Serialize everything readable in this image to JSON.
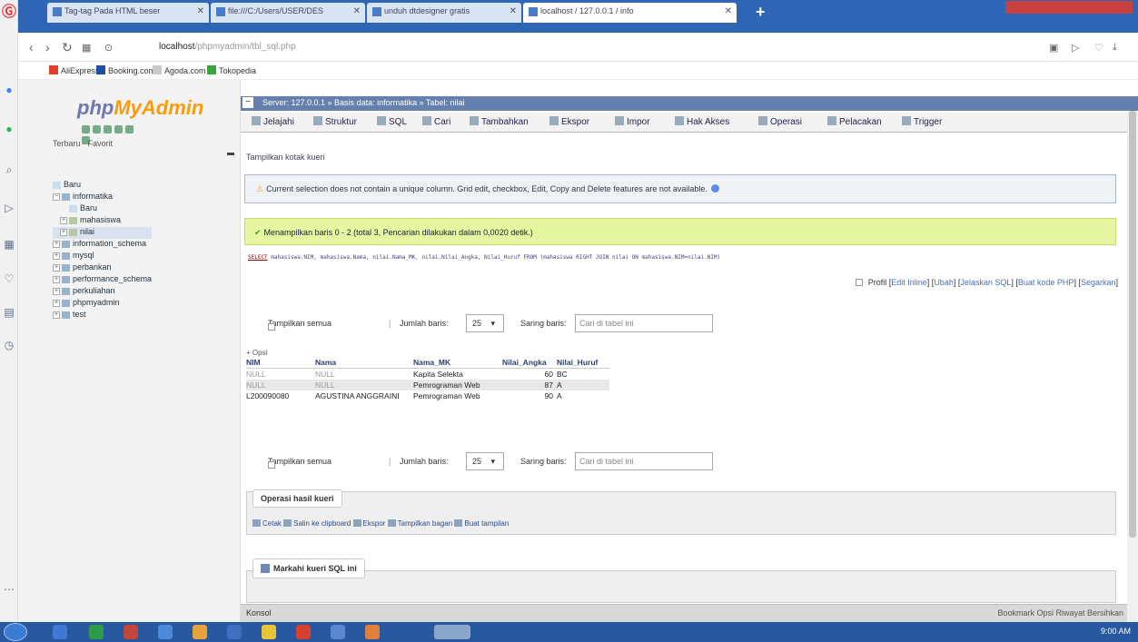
{
  "browser": {
    "tabs": [
      {
        "title": "Tag-tag Pada HTML beser"
      },
      {
        "title": "file:///C:/Users/USER/DES"
      },
      {
        "title": "unduh dtdesigner gratis"
      },
      {
        "title": "localhost / 127.0.0.1 / info"
      }
    ],
    "url_host": "localhost",
    "url_path": "/phpmyadmin/tbl_sql.php",
    "bookmarks": [
      "AliExpress",
      "Booking.com",
      "Agoda.com",
      "Tokopedia"
    ]
  },
  "sidebar": {
    "logo_a": "php",
    "logo_b": "MyAdmin",
    "recent": "Terbaru",
    "favorit": "Favorit",
    "tree": [
      {
        "label": "Baru",
        "level": 0
      },
      {
        "label": "informatika",
        "level": 0
      },
      {
        "label": "Baru",
        "level": 1
      },
      {
        "label": "mahasiswa",
        "level": 1
      },
      {
        "label": "nilai",
        "level": 1
      },
      {
        "label": "information_schema",
        "level": 0
      },
      {
        "label": "mysql",
        "level": 0
      },
      {
        "label": "perbankan",
        "level": 0
      },
      {
        "label": "performance_schema",
        "level": 0
      },
      {
        "label": "perkuliahan",
        "level": 0
      },
      {
        "label": "phpmyadmin",
        "level": 0
      },
      {
        "label": "test",
        "level": 0
      }
    ]
  },
  "breadcrumb": "Server: 127.0.0.1 » Basis data: informatika » Tabel: nilai",
  "menu": [
    "Jelajahi",
    "Struktur",
    "SQL",
    "Cari",
    "Tambahkan",
    "Ekspor",
    "Impor",
    "Hak Akses",
    "Operasi",
    "Pelacakan",
    "Trigger"
  ],
  "hint": "Tampilkan kotak kueri",
  "warning": "Current selection does not contain a unique column. Grid edit, checkbox, Edit, Copy and Delete features are not available.",
  "success": "Menampilkan baris 0 - 2 (total 3, Pencarian dilakukan dalam 0,0020 detik.)",
  "sql_keyword": "SELECT",
  "sql_rest": " mahasiswa.NIM, mahasiswa.Nama, nilai.Nama_MK, nilai.Nilai_Angka, Nilai_Huruf FROM (mahasiswa RIGHT JOIN nilai ON mahasiswa.NIM=nilai.NIM)",
  "profil": {
    "label": "Profil",
    "links": [
      "Edit Inline",
      "Ubah",
      "Jelaskan SQL",
      "Buat kode PHP",
      "Segarkan"
    ]
  },
  "controls": {
    "show_all": "Tampilkan semua",
    "rows_label": "Jumlah baris:",
    "rows_value": "25",
    "filter_label": "Saring baris:",
    "filter_placeholder": "Cari di tabel ini"
  },
  "opsi": "+ Opsi",
  "table": {
    "headers": [
      "NIM",
      "Nama",
      "Nama_MK",
      "Nilai_Angka",
      "Nilai_Huruf"
    ],
    "rows": [
      [
        "NULL",
        "NULL",
        "Kapita Selekta",
        "60",
        "BC"
      ],
      [
        "NULL",
        "NULL",
        "Pemrograman Web",
        "87",
        "A"
      ],
      [
        "L200090080",
        "AGUSTINA ANGGRAINI",
        "Pemrograman Web",
        "90",
        "A"
      ]
    ]
  },
  "query_ops": {
    "title": "Operasi hasil kueri",
    "links": [
      "Cetak",
      "Salin ke clipboard",
      "Ekspor",
      "Tampilkan bagan",
      "Buat tampilan"
    ]
  },
  "bookmark_sql": {
    "title": "Markahi kueri SQL ini"
  },
  "console": {
    "label": "Konsol",
    "right": "Bookmark  Opsi  Riwayat  Bersihkan"
  },
  "tray": {
    "time": "9:00 AM"
  }
}
